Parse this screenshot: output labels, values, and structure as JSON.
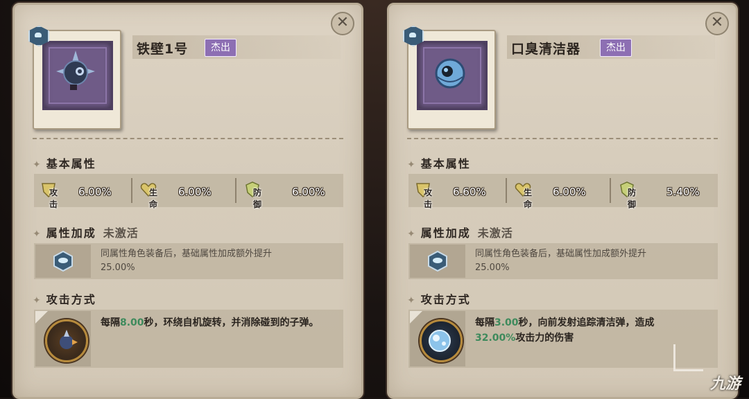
{
  "panels": [
    {
      "name": "铁壁1号",
      "rarity": "杰出",
      "close_icon": "close-icon",
      "element_icon": "cloud-element-icon",
      "basic_section": "基本属性",
      "stats": [
        {
          "label": "攻击",
          "value": "6.00%",
          "icon": "attack-shield-icon"
        },
        {
          "label": "生命",
          "value": "6.00%",
          "icon": "heart-icon"
        },
        {
          "label": "防御",
          "value": "6.00%",
          "icon": "defense-shield-icon"
        }
      ],
      "bonus_section": "属性加成",
      "bonus_status": "未激活",
      "bonus_line1": "同属性角色装备后，基础属性加成额外提升",
      "bonus_line2": "25.00%",
      "attack_section": "攻击方式",
      "attack_pre": "每隔",
      "attack_num": "8.00",
      "attack_post": "秒，环绕自机旋转，并消除碰到的子弹。"
    },
    {
      "name": "口臭清洁器",
      "rarity": "杰出",
      "close_icon": "close-icon",
      "element_icon": "cloud-element-icon",
      "basic_section": "基本属性",
      "stats": [
        {
          "label": "攻击",
          "value": "6.60%",
          "icon": "attack-shield-icon"
        },
        {
          "label": "生命",
          "value": "6.00%",
          "icon": "heart-icon"
        },
        {
          "label": "防御",
          "value": "5.40%",
          "icon": "defense-shield-icon"
        }
      ],
      "bonus_section": "属性加成",
      "bonus_status": "未激活",
      "bonus_line1": "同属性角色装备后，基础属性加成额外提升",
      "bonus_line2": "25.00%",
      "attack_section": "攻击方式",
      "attack_pre": "每隔",
      "attack_num": "3.00",
      "attack_post": "秒，向前发射追踪清洁弹，造成",
      "attack_pct": "32.00%",
      "attack_tail": "攻击力的伤害"
    }
  ],
  "watermark": "九游"
}
